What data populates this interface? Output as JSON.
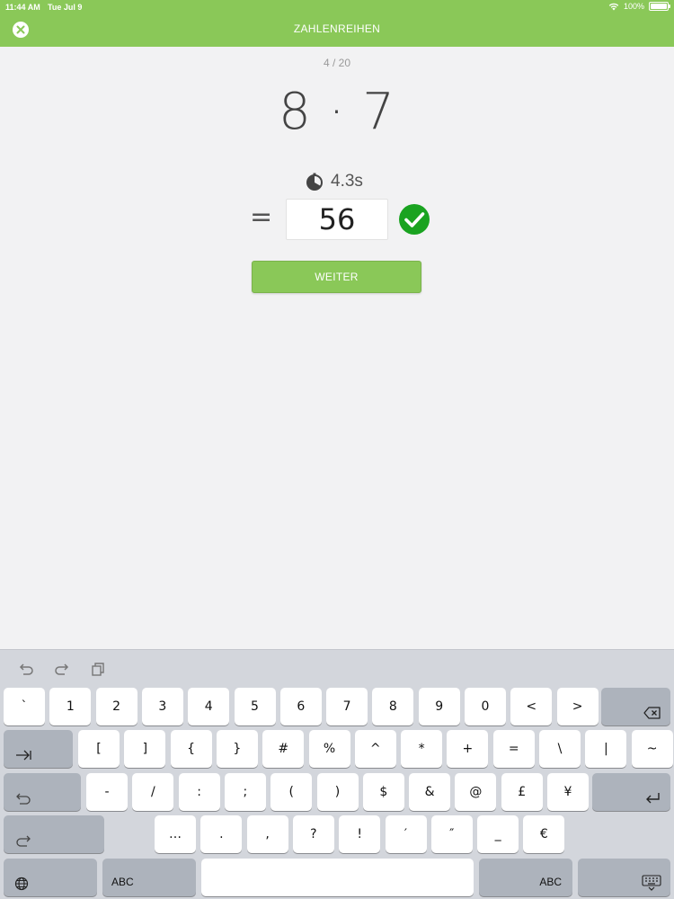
{
  "status_bar": {
    "time": "11:44 AM",
    "date": "Tue Jul 9",
    "battery": "100%",
    "battery_level": 1.0
  },
  "header": {
    "title": "ZAHLENREIHEN",
    "close_icon": "close-circle-icon",
    "background": "#8ac858"
  },
  "quiz": {
    "progress": "4 / 20",
    "task": "8 · 7",
    "timer_icon": "stopwatch-icon",
    "timer": "4.3s",
    "equals": "=",
    "answer": "56",
    "result_icon": "check-circle-icon",
    "result_color": "#1aa320",
    "next_label": "WEITER"
  },
  "keyboard": {
    "tools": [
      "undo-icon",
      "redo-icon",
      "paste-icon"
    ],
    "row1": [
      "`",
      "1",
      "2",
      "3",
      "4",
      "5",
      "6",
      "7",
      "8",
      "9",
      "0",
      "<",
      ">"
    ],
    "row2": [
      "[",
      "]",
      "{",
      "}",
      "#",
      "%",
      "^",
      "*",
      "+",
      "=",
      "\\",
      "|",
      "~"
    ],
    "row3": [
      "-",
      "/",
      ":",
      ";",
      "(",
      ")",
      "$",
      "&",
      "@",
      "£",
      "¥"
    ],
    "row4": [
      "…",
      ".",
      ",",
      "?",
      "!",
      "′",
      "″",
      "_",
      "€"
    ],
    "abc_left": "ABC",
    "abc_right": "ABC"
  }
}
